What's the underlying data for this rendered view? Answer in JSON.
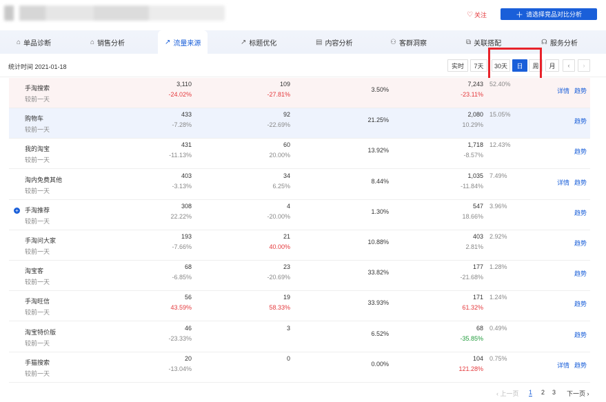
{
  "header": {
    "follow_label": "关注",
    "compare_label": "请选择竞品对比分析"
  },
  "tabs": [
    {
      "label": "单品诊断",
      "icon": "bag-icon"
    },
    {
      "label": "销售分析",
      "icon": "bag-icon"
    },
    {
      "label": "流量来源",
      "icon": "trend-icon"
    },
    {
      "label": "标题优化",
      "icon": "trend-icon"
    },
    {
      "label": "内容分析",
      "icon": "doc-icon"
    },
    {
      "label": "客群洞察",
      "icon": "user-icon"
    },
    {
      "label": "关联搭配",
      "icon": "link-icon"
    },
    {
      "label": "服务分析",
      "icon": "headset-icon"
    }
  ],
  "stat": {
    "time_label": "统计时间 2021-01-18",
    "ranges": [
      "实时",
      "7天",
      "30天",
      "日",
      "周",
      "月"
    ],
    "active_range": "日",
    "prev": "‹",
    "next": "›"
  },
  "colors": {
    "accent": "#1a5fd9",
    "negative": "#e4393c",
    "positive": "#1f9b3a",
    "highlight_box": "#e8222a"
  },
  "rows": [
    {
      "name": "手淘搜索",
      "sub": "较前一天",
      "c1": "3,110",
      "c1d": "-24.02%",
      "c1d_color": "red",
      "c2": "109",
      "c2d": "-27.81%",
      "c2d_color": "red",
      "c3": "3.50%",
      "c4": "7,243",
      "c4d": "-23.11%",
      "c4d_color": "red",
      "c5": "52.40%",
      "detail": "详情",
      "trend": "趋势",
      "highlight": "pink"
    },
    {
      "name": "购物车",
      "sub": "较前一天",
      "c1": "433",
      "c1d": "-7.28%",
      "c1d_color": "neg",
      "c2": "92",
      "c2d": "-22.69%",
      "c2d_color": "neg",
      "c3": "21.25%",
      "c4": "2,080",
      "c4d": "10.29%",
      "c4d_color": "neg",
      "c5": "15.05%",
      "detail": "",
      "trend": "趋势",
      "highlight": "blue"
    },
    {
      "name": "我的淘宝",
      "sub": "较前一天",
      "c1": "431",
      "c1d": "-11.13%",
      "c1d_color": "neg",
      "c2": "60",
      "c2d": "20.00%",
      "c2d_color": "neg",
      "c3": "13.92%",
      "c4": "1,718",
      "c4d": "-8.57%",
      "c4d_color": "neg",
      "c5": "12.43%",
      "detail": "",
      "trend": "趋势",
      "highlight": ""
    },
    {
      "name": "淘内免费其他",
      "sub": "较前一天",
      "c1": "403",
      "c1d": "-3.13%",
      "c1d_color": "neg",
      "c2": "34",
      "c2d": "6.25%",
      "c2d_color": "neg",
      "c3": "8.44%",
      "c4": "1,035",
      "c4d": "-11.84%",
      "c4d_color": "neg",
      "c5": "7.49%",
      "detail": "详情",
      "trend": "趋势",
      "highlight": ""
    },
    {
      "name": "手淘推荐",
      "sub": "较前一天",
      "c1": "308",
      "c1d": "22.22%",
      "c1d_color": "neg",
      "c2": "4",
      "c2d": "-20.00%",
      "c2d_color": "neg",
      "c3": "1.30%",
      "c4": "547",
      "c4d": "18.66%",
      "c4d_color": "neg",
      "c5": "3.96%",
      "detail": "",
      "trend": "趋势",
      "highlight": "",
      "expand": "+"
    },
    {
      "name": "手淘问大家",
      "sub": "较前一天",
      "c1": "193",
      "c1d": "-7.66%",
      "c1d_color": "neg",
      "c2": "21",
      "c2d": "40.00%",
      "c2d_color": "red",
      "c3": "10.88%",
      "c4": "403",
      "c4d": "2.81%",
      "c4d_color": "neg",
      "c5": "2.92%",
      "detail": "",
      "trend": "趋势",
      "highlight": ""
    },
    {
      "name": "淘宝客",
      "sub": "较前一天",
      "c1": "68",
      "c1d": "-6.85%",
      "c1d_color": "neg",
      "c2": "23",
      "c2d": "-20.69%",
      "c2d_color": "neg",
      "c3": "33.82%",
      "c4": "177",
      "c4d": "-21.68%",
      "c4d_color": "neg",
      "c5": "1.28%",
      "detail": "",
      "trend": "趋势",
      "highlight": ""
    },
    {
      "name": "手淘旺信",
      "sub": "较前一天",
      "c1": "56",
      "c1d": "43.59%",
      "c1d_color": "red",
      "c2": "19",
      "c2d": "58.33%",
      "c2d_color": "red",
      "c3": "33.93%",
      "c4": "171",
      "c4d": "61.32%",
      "c4d_color": "red",
      "c5": "1.24%",
      "detail": "",
      "trend": "趋势",
      "highlight": ""
    },
    {
      "name": "淘宝特价版",
      "sub": "较前一天",
      "c1": "46",
      "c1d": "-23.33%",
      "c1d_color": "neg",
      "c2": "3",
      "c2d": "",
      "c2d_color": "neg",
      "c3": "6.52%",
      "c4": "68",
      "c4d": "-35.85%",
      "c4d_color": "green",
      "c5": "0.49%",
      "detail": "",
      "trend": "趋势",
      "highlight": ""
    },
    {
      "name": "手猫搜索",
      "sub": "较前一天",
      "c1": "20",
      "c1d": "-13.04%",
      "c1d_color": "neg",
      "c2": "0",
      "c2d": "",
      "c2d_color": "neg",
      "c3": "0.00%",
      "c4": "104",
      "c4d": "121.28%",
      "c4d_color": "red",
      "c5": "0.75%",
      "detail": "详情",
      "trend": "趋势",
      "highlight": ""
    }
  ],
  "pager": {
    "prev": "‹ 上一页",
    "pages": [
      "1",
      "2",
      "3"
    ],
    "active": "1",
    "next": "下一页 ›"
  }
}
